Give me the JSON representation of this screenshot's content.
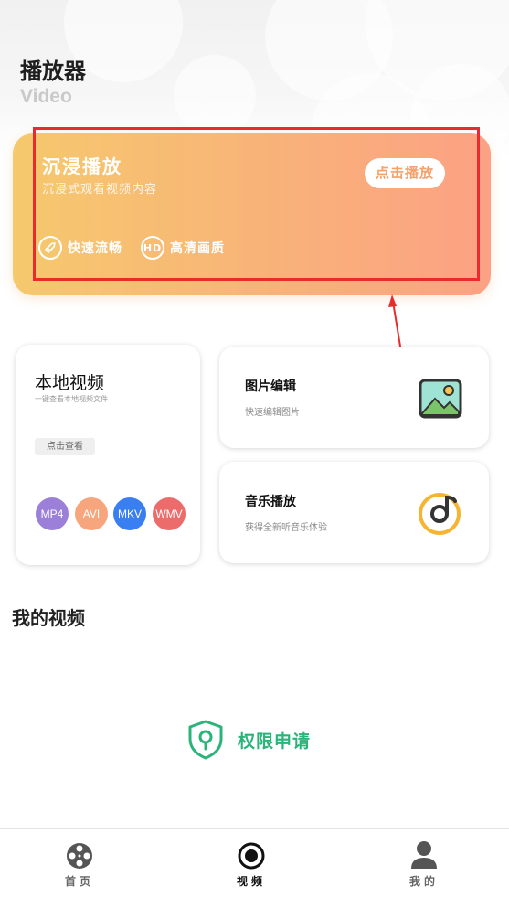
{
  "header": {
    "title": "播放器",
    "subtitle": "Video"
  },
  "hero": {
    "title": "沉浸播放",
    "subtitle": "沉浸式观看视频内容",
    "play_button": "点击播放",
    "features": [
      {
        "icon": "rocket-icon",
        "label": "快速流畅"
      },
      {
        "icon": "hd-icon",
        "icon_text": "HD",
        "label": "高清画质"
      }
    ],
    "colors": {
      "start": "#f6c96d",
      "end": "#fca184",
      "highlight_frame": "#e82c2c"
    }
  },
  "local_video": {
    "title": "本地视频",
    "subtitle": "一键查看本地视频文件",
    "button": "点击查看",
    "formats": [
      {
        "label": "MP4",
        "color": "#9b7fd8"
      },
      {
        "label": "AVI",
        "color": "#f7a57c"
      },
      {
        "label": "MKV",
        "color": "#3a7ff1"
      },
      {
        "label": "WMV",
        "color": "#ec6c6c"
      }
    ]
  },
  "image_edit": {
    "title": "图片编辑",
    "subtitle": "快速编辑图片",
    "icon": "image-edit-icon"
  },
  "music": {
    "title": "音乐播放",
    "subtitle": "获得全新听音乐体验",
    "icon": "music-disc-icon"
  },
  "my_videos": {
    "title": "我的视频",
    "permission_label": "权限申请",
    "permission_icon": "shield-location-icon",
    "accent": "#2bb47a"
  },
  "tabbar": {
    "tabs": [
      {
        "label": "首页",
        "icon": "film-reel-icon",
        "active": false
      },
      {
        "label": "视频",
        "icon": "record-icon",
        "active": true
      },
      {
        "label": "我的",
        "icon": "user-icon",
        "active": false
      }
    ]
  }
}
